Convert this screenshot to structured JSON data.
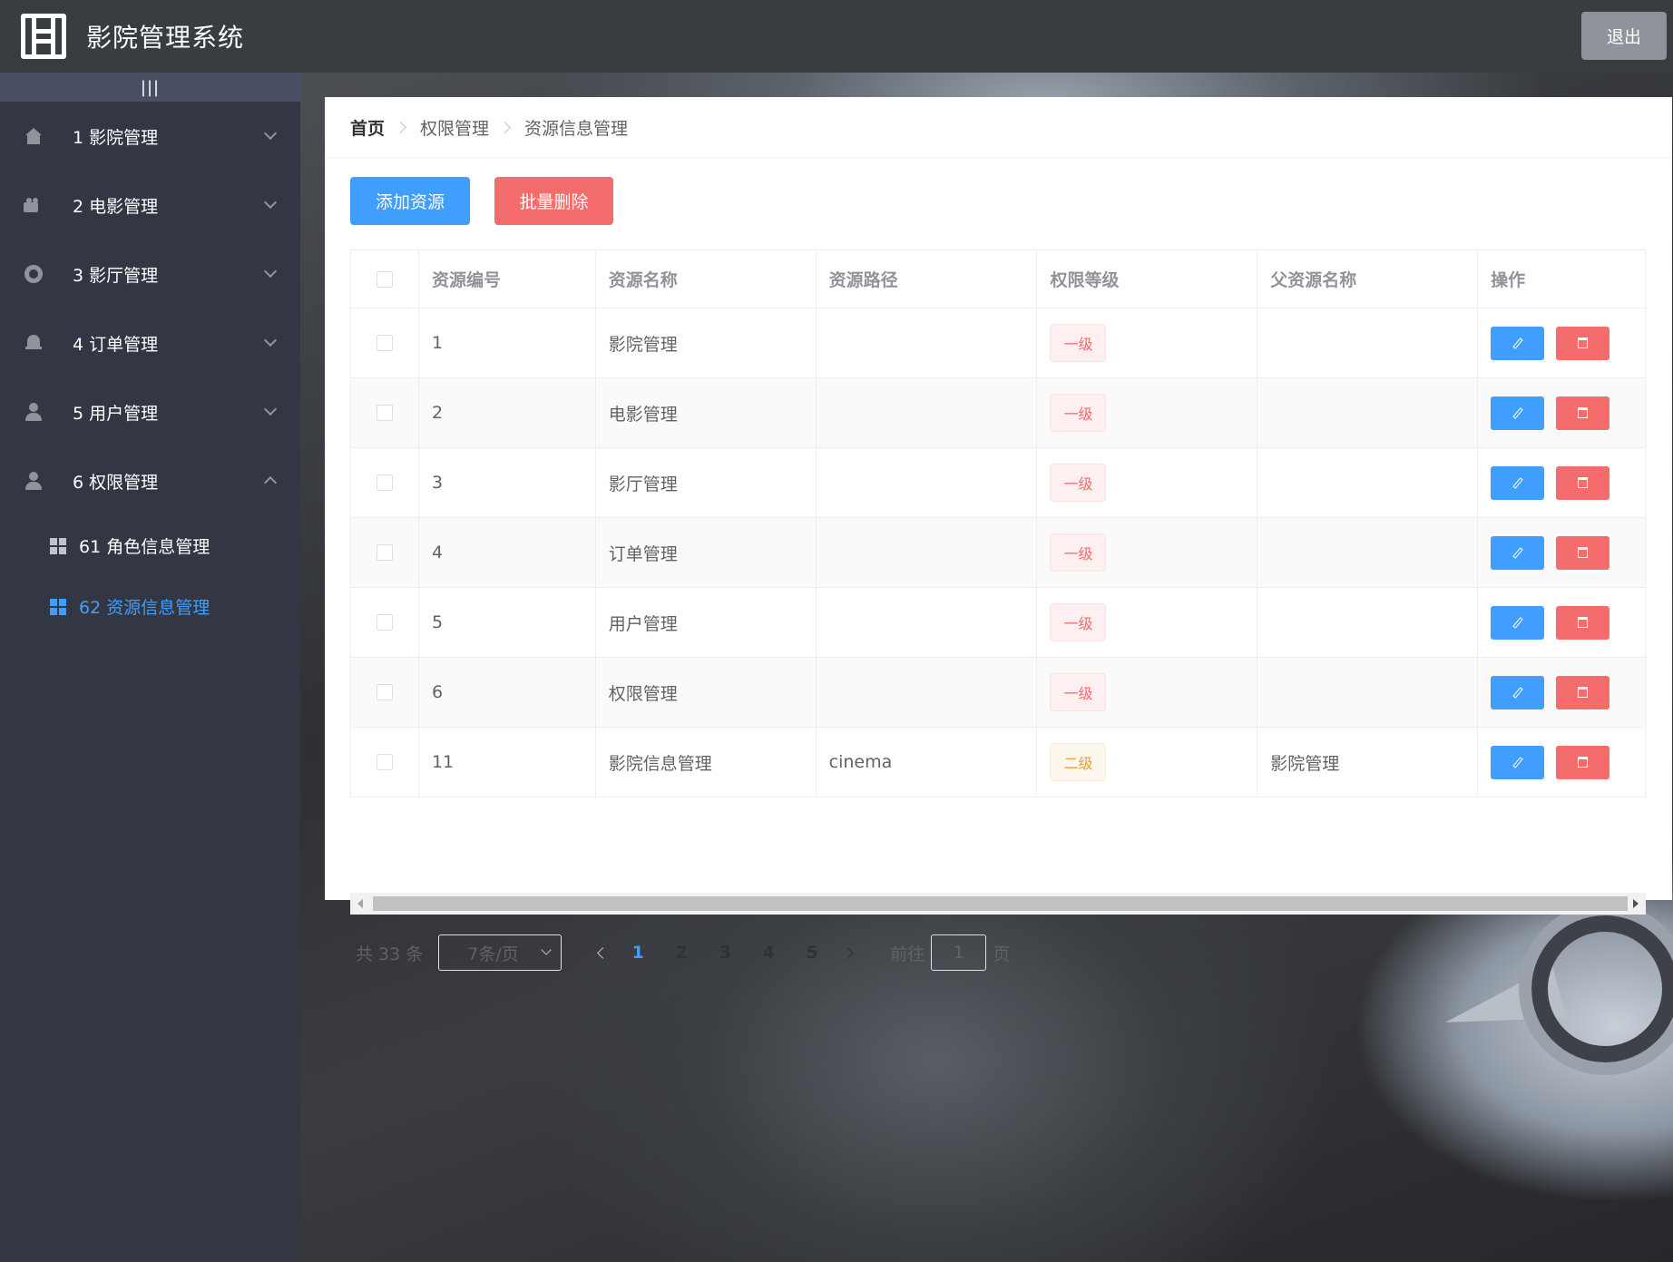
{
  "header": {
    "title": "影院管理系统",
    "logout_label": "退出"
  },
  "sidebar": {
    "collapse_label": "|||",
    "menus": [
      {
        "label": "1 影院管理",
        "icon": "home-icon"
      },
      {
        "label": "2 电影管理",
        "icon": "camera-icon"
      },
      {
        "label": "3 影厅管理",
        "icon": "help-icon"
      },
      {
        "label": "4 订单管理",
        "icon": "bell-icon"
      },
      {
        "label": "5 用户管理",
        "icon": "user-icon"
      },
      {
        "label": "6 权限管理",
        "icon": "user-icon",
        "expanded": true
      }
    ],
    "submenus": [
      {
        "label": "61 角色信息管理"
      },
      {
        "label": "62 资源信息管理",
        "active": true
      }
    ]
  },
  "breadcrumb": [
    "首页",
    "权限管理",
    "资源信息管理"
  ],
  "toolbar": {
    "add_label": "添加资源",
    "batch_delete_label": "批量删除"
  },
  "table": {
    "columns": [
      "资源编号",
      "资源名称",
      "资源路径",
      "权限等级",
      "父资源名称",
      "操作"
    ],
    "rows": [
      {
        "id": "1",
        "name": "影院管理",
        "path": "",
        "level": "一级",
        "parent": ""
      },
      {
        "id": "2",
        "name": "电影管理",
        "path": "",
        "level": "一级",
        "parent": ""
      },
      {
        "id": "3",
        "name": "影厅管理",
        "path": "",
        "level": "一级",
        "parent": ""
      },
      {
        "id": "4",
        "name": "订单管理",
        "path": "",
        "level": "一级",
        "parent": ""
      },
      {
        "id": "5",
        "name": "用户管理",
        "path": "",
        "level": "一级",
        "parent": ""
      },
      {
        "id": "6",
        "name": "权限管理",
        "path": "",
        "level": "一级",
        "parent": ""
      },
      {
        "id": "11",
        "name": "影院信息管理",
        "path": "cinema",
        "level": "二级",
        "parent": "影院管理"
      }
    ]
  },
  "pagination": {
    "total_label": "共 33 条",
    "page_size": "7条/页",
    "pages": [
      "1",
      "2",
      "3",
      "4",
      "5"
    ],
    "current_page": "1",
    "goto_label": "前往",
    "goto_value": "1",
    "page_suffix": "页"
  },
  "colors": {
    "primary": "#409eff",
    "danger": "#f56c6c",
    "warning": "#e6a23c",
    "sidebar_bg": "#333744",
    "header_bg": "#373d41"
  }
}
